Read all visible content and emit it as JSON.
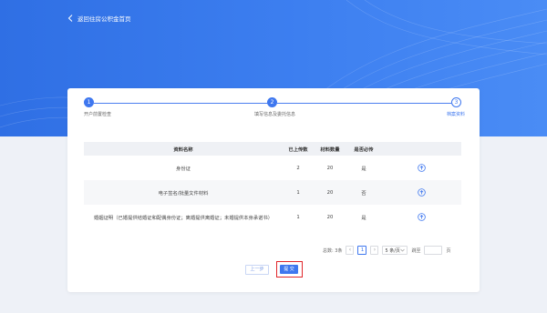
{
  "header": {
    "back_label": "返回住房公积金首页"
  },
  "steps": [
    {
      "num": "1",
      "label": "开户前置检查",
      "state": "done"
    },
    {
      "num": "2",
      "label": "填写信息及委托信息",
      "state": "done"
    },
    {
      "num": "3",
      "label": "档案资料",
      "state": "active"
    }
  ],
  "table": {
    "headers": [
      "资料名称",
      "已上传数",
      "材料数量",
      "是否必传",
      ""
    ],
    "rows": [
      {
        "name": "身份证",
        "uploaded": "2",
        "quantity": "20",
        "required": "是",
        "action_icon": "upload-icon"
      },
      {
        "name": "电子签名/批量文件材料",
        "uploaded": "1",
        "quantity": "20",
        "required": "否",
        "action_icon": "upload-icon"
      },
      {
        "name": "婚姻证明（已婚提供结婚证和配偶身份证；离婚提供离婚证；未婚提供本身承诺书）",
        "uploaded": "1",
        "quantity": "20",
        "required": "是",
        "action_icon": "upload-icon"
      }
    ]
  },
  "pagination": {
    "total_label": "总数: 3条",
    "current_page": "1",
    "page_size": "5 条/页",
    "jump_label": "跳至",
    "page_suffix": "页"
  },
  "actions": {
    "prev_label": "上一步",
    "submit_label": "提 交"
  },
  "colors": {
    "primary": "#3e77ef",
    "hero": "#3d7ff0",
    "highlight": "#e0262b"
  }
}
